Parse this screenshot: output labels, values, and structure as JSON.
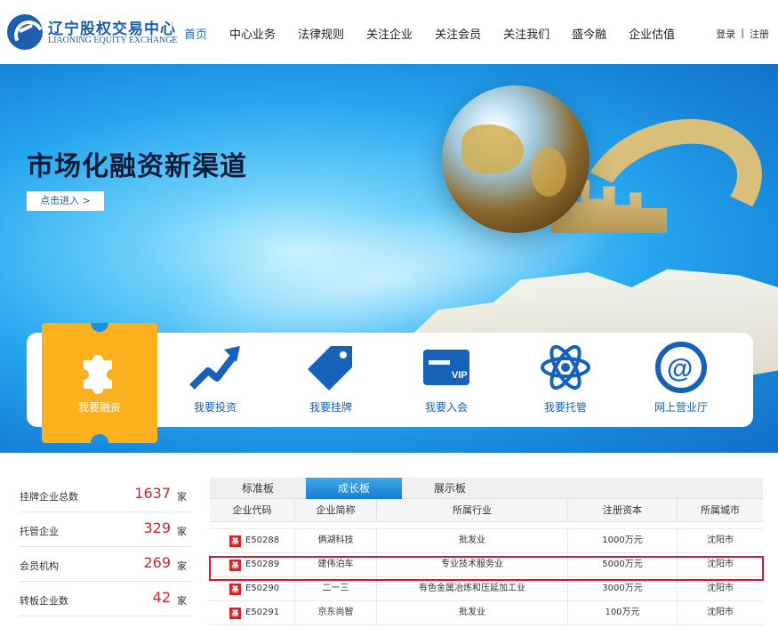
{
  "header": {
    "logo_cn": "辽宁股权交易中心",
    "logo_en": "LIAONING EQUITY EXCHANGE",
    "nav": [
      "首页",
      "中心业务",
      "法律规则",
      "关注企业",
      "关注会员",
      "关注我们",
      "盛今融",
      "企业估值"
    ],
    "active_nav": "首页",
    "login": "登录",
    "auth_sep": "|",
    "register": "注册"
  },
  "banner": {
    "title": "市场化融资新渠道",
    "enter_button": "点击进入 >"
  },
  "quick_actions": [
    {
      "label": "我要融资",
      "icon": "puzzle-icon",
      "active": true
    },
    {
      "label": "我要投资",
      "icon": "trend-arrow-icon",
      "active": false
    },
    {
      "label": "我要挂牌",
      "icon": "tag-icon",
      "active": false
    },
    {
      "label": "我要入会",
      "icon": "vip-card-icon",
      "active": false
    },
    {
      "label": "我要托管",
      "icon": "atom-icon",
      "active": false
    },
    {
      "label": "网上营业厅",
      "icon": "at-sign-icon",
      "active": false
    }
  ],
  "stats": [
    {
      "label": "挂牌企业总数",
      "value": "1637",
      "unit": "家"
    },
    {
      "label": "托管企业",
      "value": "329",
      "unit": "家"
    },
    {
      "label": "会员机构",
      "value": "269",
      "unit": "家"
    },
    {
      "label": "转板企业数",
      "value": "42",
      "unit": "家"
    }
  ],
  "board_tabs": [
    "标准板",
    "成长板",
    "展示板"
  ],
  "active_tab": "成长板",
  "table": {
    "headers": [
      "企业代码",
      "企业简称",
      "所属行业",
      "注册资本",
      "所属城市"
    ],
    "badge_text": "基",
    "rows": [
      [
        "E50288",
        "俩湖科技",
        "批发业",
        "1000万元",
        "沈阳市"
      ],
      [
        "E50289",
        "建伟泊车",
        "专业技术服务业",
        "5000万元",
        "沈阳市"
      ],
      [
        "E50290",
        "二一三",
        "有色金属冶炼和压延加工业",
        "3000万元",
        "沈阳市"
      ],
      [
        "E50291",
        "京东尚智",
        "批发业",
        "100万元",
        "沈阳市"
      ]
    ],
    "highlighted_row": 1
  },
  "colors": {
    "brand_blue": "#1b5fae",
    "accent_red": "#d8232a",
    "highlight": "#e0102f",
    "tab_orange": "#fbb11d"
  }
}
